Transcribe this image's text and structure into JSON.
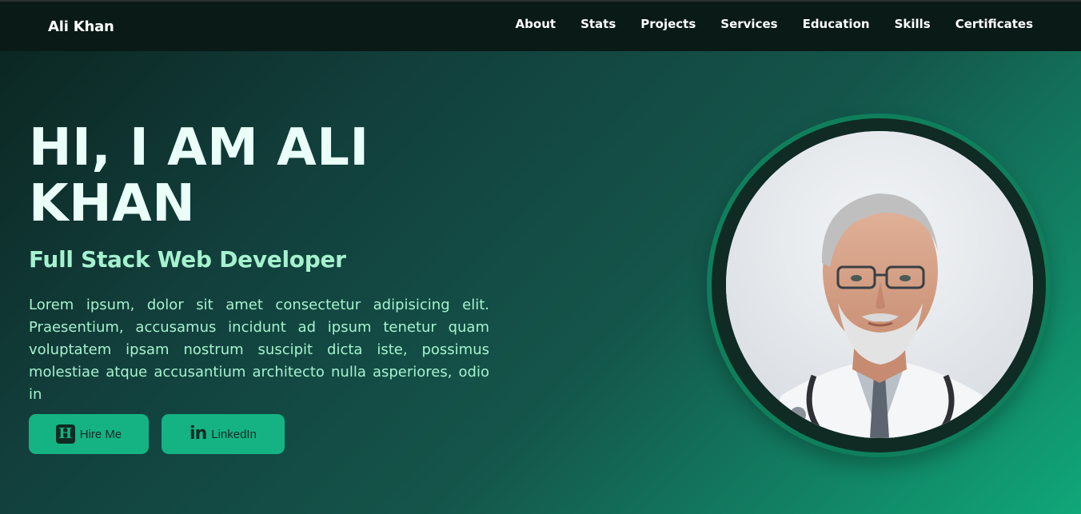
{
  "navbar": {
    "brand": "Ali Khan",
    "links": [
      "About",
      "Stats",
      "Projects",
      "Services",
      "Education",
      "Skills",
      "Certificates"
    ]
  },
  "hero": {
    "title_line1": "HI, I AM ALI",
    "title_line2": "KHAN",
    "subtitle": "Full Stack Web Developer",
    "description": "Lorem ipsum, dolor sit amet consectetur adipisicing elit. Praesentium, accusamus incidunt ad ipsum tenetur quam voluptatem ipsam nostrum suscipit dicta iste, possimus molestiae atque accusantium architecto nulla asperiores, odio in",
    "buttons": {
      "hire": {
        "label": "Hire Me",
        "icon": "hire-h-icon",
        "icon_text": "H"
      },
      "linkedin": {
        "label": "LinkedIn",
        "icon": "linkedin-icon",
        "icon_text": "in"
      }
    },
    "avatar": {
      "alt": "portrait"
    }
  },
  "colors": {
    "accent": "#15b383",
    "nav_bg": "#0a1a16",
    "title": "#e9fff7",
    "subtitle": "#a6f2cf"
  }
}
